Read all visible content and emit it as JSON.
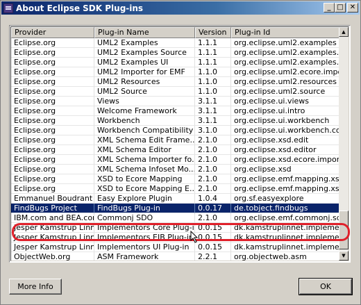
{
  "window": {
    "title": "About Eclipse SDK Plug-ins",
    "controls": [
      "_",
      "□",
      "✕"
    ]
  },
  "table": {
    "columns": [
      "Provider",
      "Plug-in Name",
      "Version",
      "Plug-in Id"
    ],
    "rows": [
      [
        "Eclipse.org",
        "UML2 Examples",
        "1.1.1",
        "org.eclipse.uml2.examples"
      ],
      [
        "Eclipse.org",
        "UML2 Examples Source",
        "1.1.1",
        "org.eclipse.uml2.examples...."
      ],
      [
        "Eclipse.org",
        "UML2 Examples UI",
        "1.1.1",
        "org.eclipse.uml2.examples.ui"
      ],
      [
        "Eclipse.org",
        "UML2 Importer for EMF",
        "1.1.0",
        "org.eclipse.uml2.ecore.impo..."
      ],
      [
        "Eclipse.org",
        "UML2 Resources",
        "1.1.0",
        "org.eclipse.uml2.resources"
      ],
      [
        "Eclipse.org",
        "UML2 Source",
        "1.1.0",
        "org.eclipse.uml2.source"
      ],
      [
        "Eclipse.org",
        "Views",
        "3.1.1",
        "org.eclipse.ui.views"
      ],
      [
        "Eclipse.org",
        "Welcome Framework",
        "3.1.1",
        "org.eclipse.ui.intro"
      ],
      [
        "Eclipse.org",
        "Workbench",
        "3.1.1",
        "org.eclipse.ui.workbench"
      ],
      [
        "Eclipse.org",
        "Workbench Compatibility",
        "3.1.0",
        "org.eclipse.ui.workbench.co..."
      ],
      [
        "Eclipse.org",
        "XML Schema Edit Frame...",
        "2.1.0",
        "org.eclipse.xsd.edit"
      ],
      [
        "Eclipse.org",
        "XML Schema Editor",
        "2.1.0",
        "org.eclipse.xsd.editor"
      ],
      [
        "Eclipse.org",
        "XML Schema Importer fo...",
        "2.1.0",
        "org.eclipse.xsd.ecore.impor..."
      ],
      [
        "Eclipse.org",
        "XML Schema Infoset Mo...",
        "2.1.0",
        "org.eclipse.xsd"
      ],
      [
        "Eclipse.org",
        "XSD to Ecore Mapping",
        "2.1.0",
        "org.eclipse.emf.mapping.xs..."
      ],
      [
        "Eclipse.org",
        "XSD to Ecore Mapping E...",
        "2.1.0",
        "org.eclipse.emf.mapping.xs..."
      ],
      [
        "Emmanuel Boudrant",
        "Easy Explore Plugin",
        "1.0.4",
        "org.sf.easyexplore"
      ],
      [
        "FindBugs Project",
        "FindBugs Plug-in",
        "0.0.17",
        "de.tobject.findbugs"
      ],
      [
        "IBM.com and BEA.com",
        "Commonj SDO",
        "2.1.0",
        "org.eclipse.emf.commonj.sdo"
      ],
      [
        "Jesper Kamstrup Linnet",
        "Implementors Core Plug-in",
        "0.0.15",
        "dk.kamstruplinnet.implemen..."
      ],
      [
        "Jesper Kamstrup Linnet",
        "Implementors EJB Plug-in",
        "0.0.15",
        "dk.kamstruplinnet.implemen..."
      ],
      [
        "Jesper Kamstrup Linnet",
        "Implementors UI Plug-in",
        "0.0.15",
        "dk.kamstruplinnet.implemen..."
      ],
      [
        "ObjectWeb.org",
        "ASM Framework",
        "2.2.1",
        "org.objectweb.asm"
      ]
    ],
    "selected_index": 17
  },
  "buttons": {
    "more_info": "More Info",
    "ok": "OK"
  },
  "colors": {
    "selection": "#0a246a",
    "highlight_oval": "#e0202a"
  }
}
